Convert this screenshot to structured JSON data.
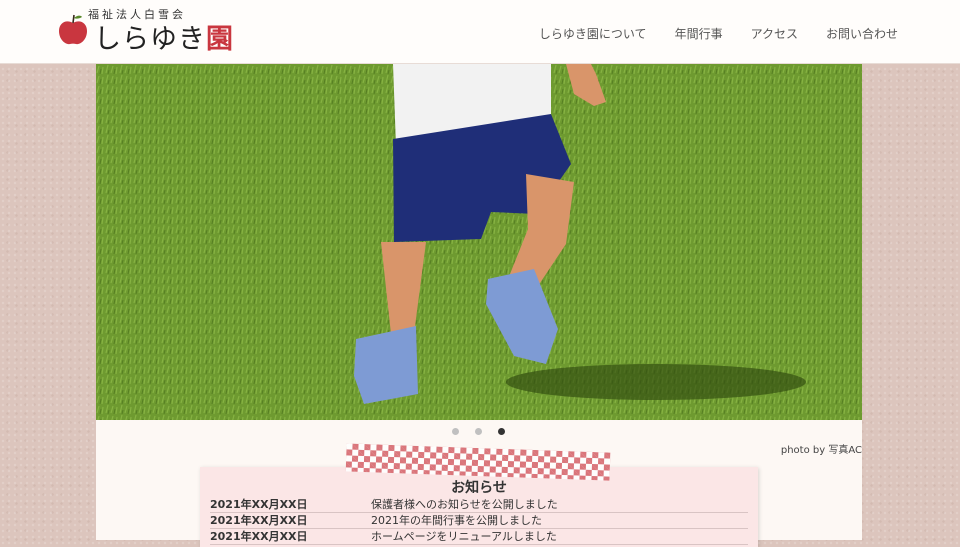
{
  "header": {
    "logo_subtitle": "福祉法人白雪会",
    "logo_name": "しらゆき",
    "logo_accent": "園"
  },
  "nav": {
    "items": [
      {
        "label": "しらゆき園について"
      },
      {
        "label": "年間行事"
      },
      {
        "label": "アクセス"
      },
      {
        "label": "お問い合わせ"
      }
    ]
  },
  "carousel": {
    "dot_count": 3,
    "active_index": 2,
    "photo_credit": "photo by 写真AC"
  },
  "news": {
    "title": "お知らせ",
    "items": [
      {
        "date": "2021年XX月XX日",
        "text": "保護者様へのお知らせを公開しました"
      },
      {
        "date": "2021年XX月XX日",
        "text": "2021年の年間行事を公開しました"
      },
      {
        "date": "2021年XX月XX日",
        "text": "ホームページをリニューアルしました"
      }
    ]
  },
  "colors": {
    "accent": "#c9363f",
    "header_bg": "#fffdfb",
    "page_bg": "#dcc5bd",
    "news_bg": "#fbe6e6"
  }
}
